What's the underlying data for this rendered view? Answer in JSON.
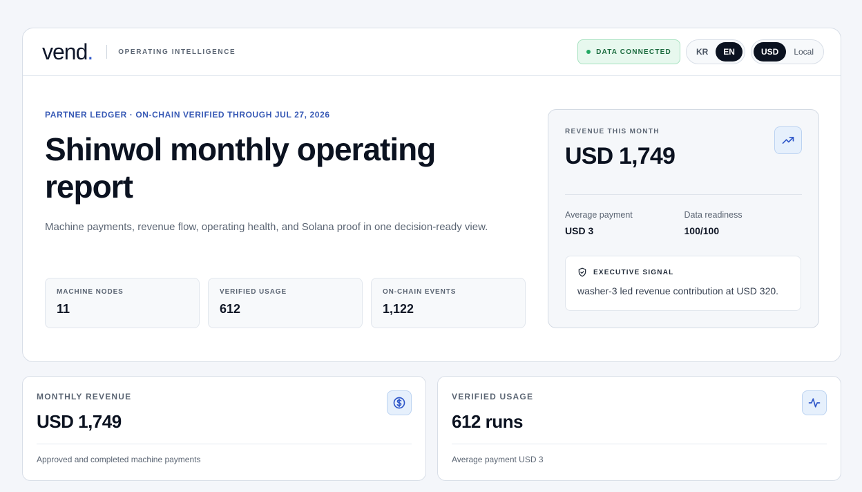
{
  "header": {
    "logo_text": "vend",
    "logo_dot": ".",
    "tagline": "OPERATING INTELLIGENCE",
    "status": "DATA CONNECTED",
    "language_options": [
      "KR",
      "EN"
    ],
    "language_selected": "EN",
    "currency_options": [
      "USD",
      "Local"
    ],
    "currency_selected": "USD"
  },
  "hero": {
    "eyebrow": "PARTNER LEDGER · ON-CHAIN VERIFIED THROUGH JUL 27, 2026",
    "title": "Shinwol monthly operating report",
    "subtitle": "Machine payments, revenue flow, operating health, and Solana proof in one decision-ready view.",
    "metrics": [
      {
        "label": "MACHINE NODES",
        "value": "11"
      },
      {
        "label": "VERIFIED USAGE",
        "value": "612"
      },
      {
        "label": "ON-CHAIN EVENTS",
        "value": "1,122"
      }
    ]
  },
  "revenue_panel": {
    "label": "REVENUE THIS MONTH",
    "value": "USD 1,749",
    "icon": "trending-up-icon",
    "stats": [
      {
        "label": "Average payment",
        "value": "USD 3"
      },
      {
        "label": "Data readiness",
        "value": "100/100"
      }
    ],
    "signal": {
      "icon": "shield-check-icon",
      "title": "EXECUTIVE SIGNAL",
      "text": "washer-3 led revenue contribution at USD 320."
    }
  },
  "cards": [
    {
      "label": "MONTHLY REVENUE",
      "value": "USD 1,749",
      "note": "Approved and completed machine payments",
      "icon": "dollar-circle-icon"
    },
    {
      "label": "VERIFIED USAGE",
      "value": "612 runs",
      "note": "Average payment USD 3",
      "icon": "activity-pulse-icon"
    }
  ],
  "colors": {
    "accent": "#2f57c9",
    "eyebrow": "#3759b5",
    "status_green": "#22a862",
    "dark": "#0b1220",
    "icon_bg": "#e6f0fc"
  }
}
